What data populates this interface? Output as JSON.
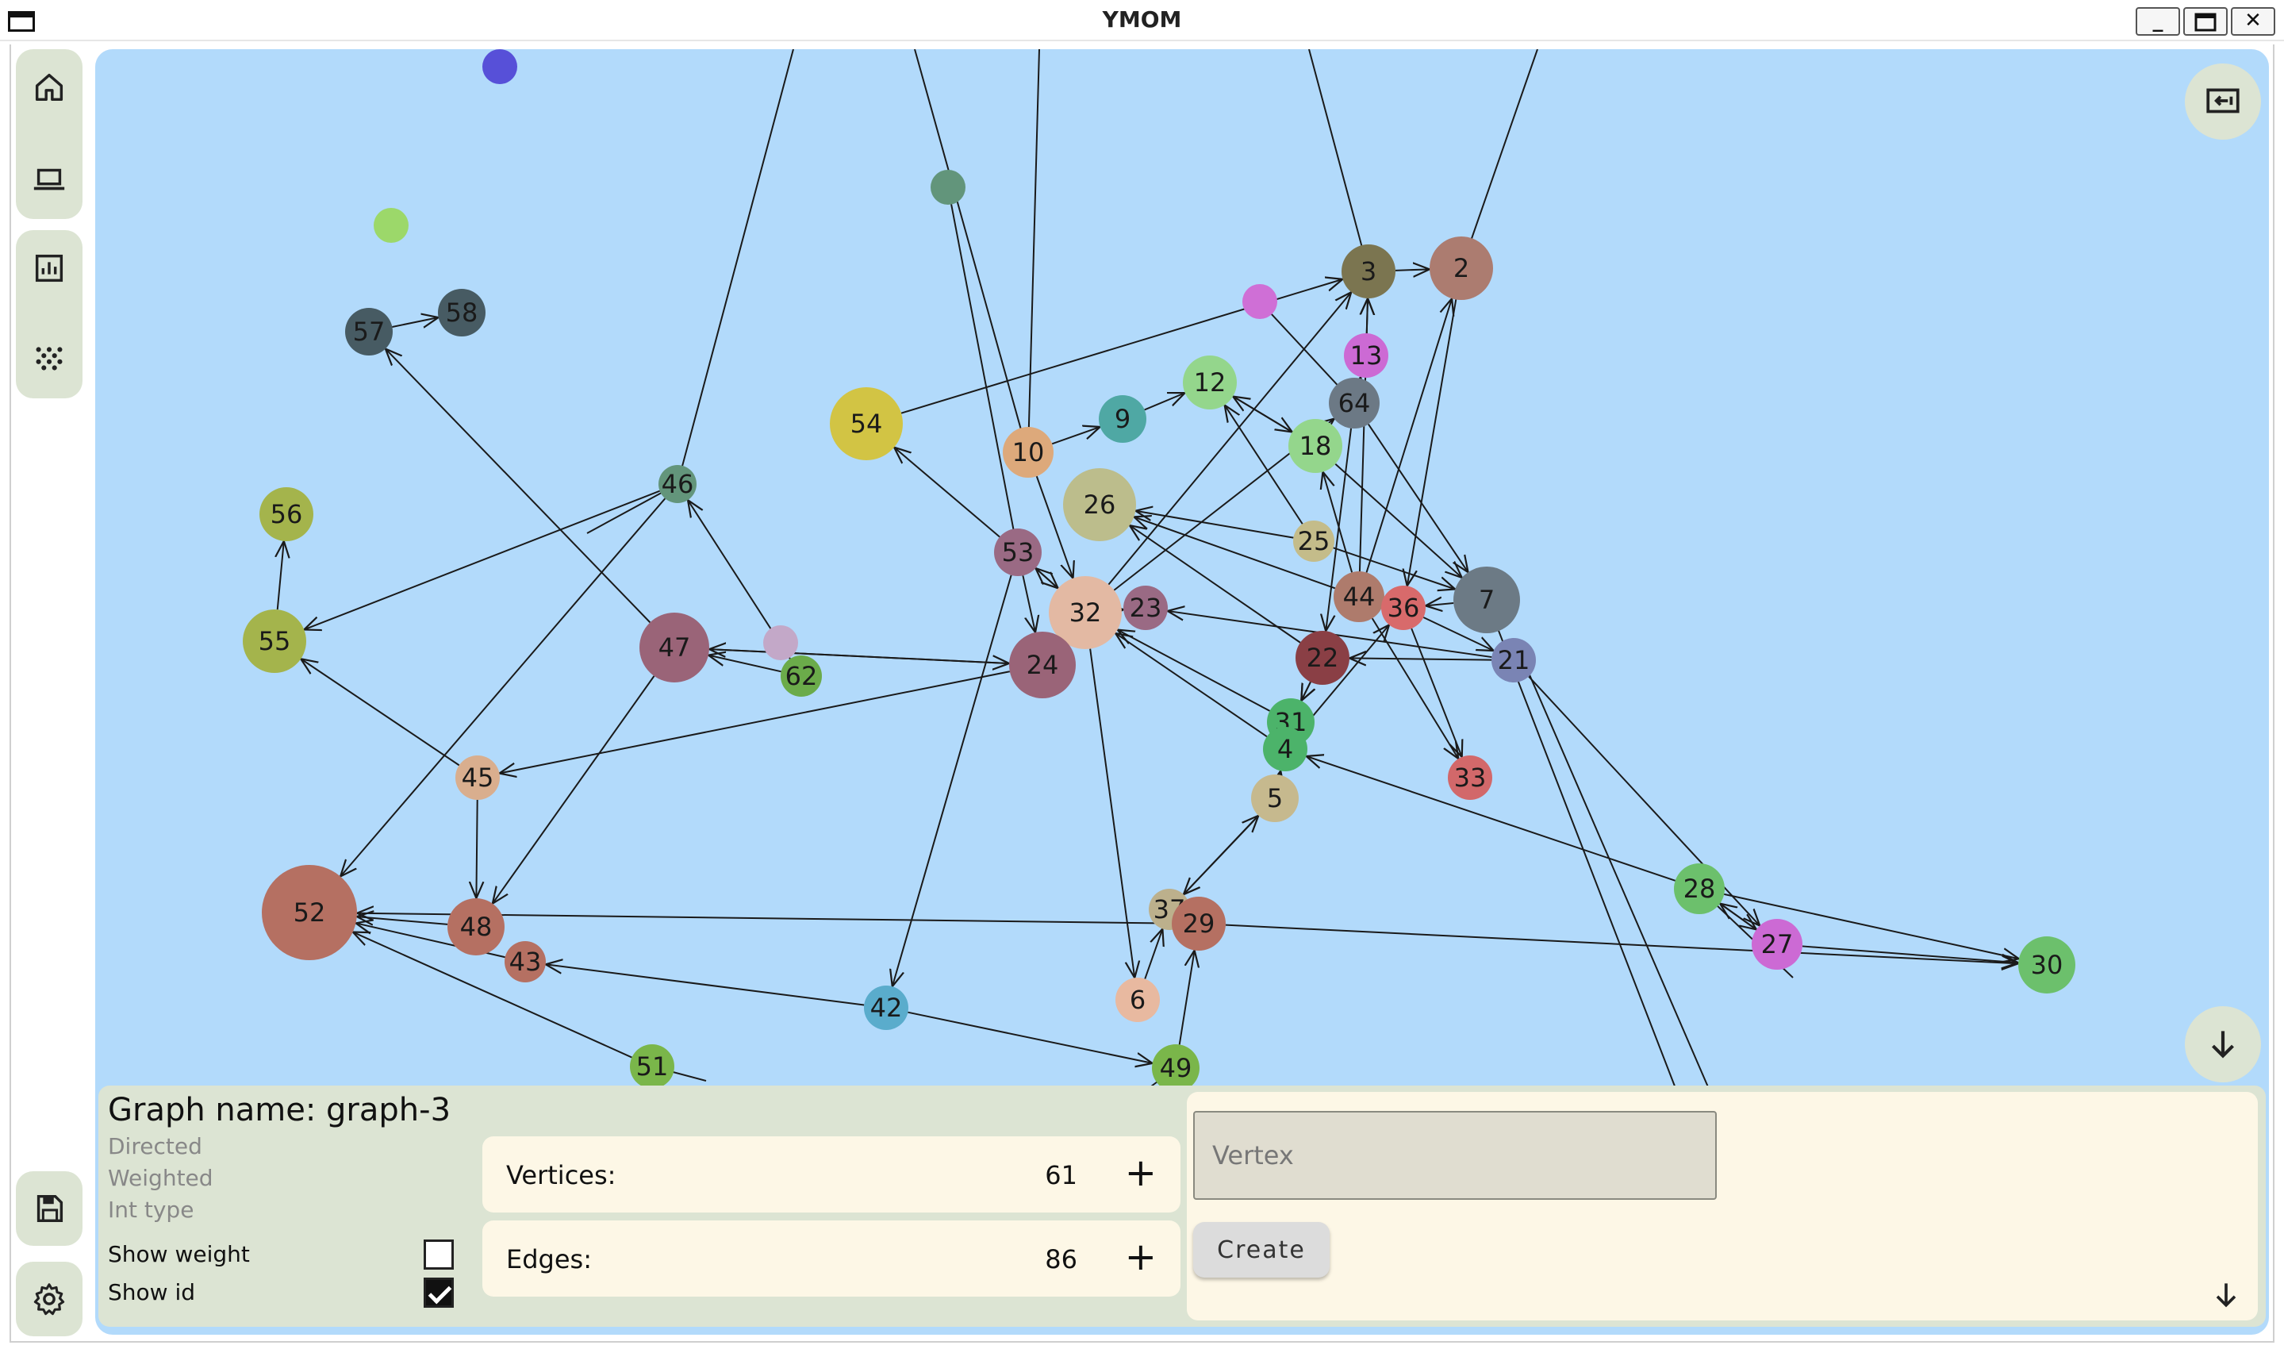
{
  "window": {
    "title": "YMOM"
  },
  "sidebar": {
    "top_items": [
      {
        "icon": "home-icon"
      },
      {
        "icon": "laptop-icon"
      },
      {
        "icon": "chart-icon"
      },
      {
        "icon": "dots-grid-icon"
      }
    ],
    "bottom_items": [
      {
        "icon": "save-icon"
      },
      {
        "icon": "gear-icon"
      }
    ]
  },
  "graph": {
    "vertices": [
      {
        "id": "",
        "color": "#5750d8"
      },
      {
        "id": "",
        "color": "#9cd86a"
      },
      {
        "id": "",
        "color": "#62957b"
      },
      {
        "id": "",
        "color": "#cf6fd6"
      },
      {
        "id": "",
        "color": "#c3a8c8"
      },
      {
        "id": "3",
        "color": "#7b7550"
      },
      {
        "id": "2",
        "color": "#ac7c70"
      },
      {
        "id": "13",
        "color": "#cc6ad4"
      },
      {
        "id": "64",
        "color": "#6c7985"
      },
      {
        "id": "57",
        "color": "#475b63"
      },
      {
        "id": "58",
        "color": "#475b63"
      },
      {
        "id": "54",
        "color": "#d2c444"
      },
      {
        "id": "12",
        "color": "#94d68c"
      },
      {
        "id": "9",
        "color": "#4fa8a4"
      },
      {
        "id": "10",
        "color": "#dda97b"
      },
      {
        "id": "18",
        "color": "#94d68c"
      },
      {
        "id": "46",
        "color": "#63957b"
      },
      {
        "id": "56",
        "color": "#a4b44c"
      },
      {
        "id": "26",
        "color": "#bcbd8c"
      },
      {
        "id": "25",
        "color": "#c4bc8a"
      },
      {
        "id": "53",
        "color": "#9a6a84"
      },
      {
        "id": "7",
        "color": "#6c7a85"
      },
      {
        "id": "44",
        "color": "#ae7b6c"
      },
      {
        "id": "36",
        "color": "#d86a6b"
      },
      {
        "id": "55",
        "color": "#a4b44c"
      },
      {
        "id": "47",
        "color": "#9a6478"
      },
      {
        "id": "32",
        "color": "#e3b9a3"
      },
      {
        "id": "23",
        "color": "#9a6a84"
      },
      {
        "id": "21",
        "color": "#7a84b4"
      },
      {
        "id": "22",
        "color": "#8a3f45"
      },
      {
        "id": "24",
        "color": "#9a6478"
      },
      {
        "id": "62",
        "color": "#6bab4a"
      },
      {
        "id": "31",
        "color": "#4cb36a"
      },
      {
        "id": "4",
        "color": "#4cb36a"
      },
      {
        "id": "45",
        "color": "#d9ae8e"
      },
      {
        "id": "33",
        "color": "#d2686a"
      },
      {
        "id": "5",
        "color": "#c6b98e"
      },
      {
        "id": "28",
        "color": "#6cc06c"
      },
      {
        "id": "52",
        "color": "#b57062"
      },
      {
        "id": "48",
        "color": "#b57062"
      },
      {
        "id": "37",
        "color": "#bcb08c"
      },
      {
        "id": "29",
        "color": "#b57062"
      },
      {
        "id": "27",
        "color": "#cc6ad4"
      },
      {
        "id": "30",
        "color": "#6cc06c"
      },
      {
        "id": "43",
        "color": "#b57062"
      },
      {
        "id": "6",
        "color": "#e8b9a0"
      },
      {
        "id": "42",
        "color": "#5aaccc"
      },
      {
        "id": "51",
        "color": "#7ab64a"
      },
      {
        "id": "49",
        "color": "#7ab64a"
      }
    ],
    "edges": [
      [
        "57",
        "58"
      ],
      [
        "46",
        "55"
      ],
      [
        "46",
        "52"
      ],
      [
        "47",
        "57"
      ],
      [
        "62",
        "46"
      ],
      [
        "54",
        "3"
      ],
      [
        "10",
        "9"
      ],
      [
        "9",
        "12"
      ],
      [
        "12",
        "18"
      ],
      [
        "18",
        "12"
      ],
      [
        "10",
        "32"
      ],
      [
        "53",
        "54"
      ],
      [
        "53",
        "32"
      ],
      [
        "53",
        "24"
      ],
      [
        "32",
        "53"
      ],
      [
        "32",
        "3"
      ],
      [
        "32",
        "64"
      ],
      [
        "25",
        "26"
      ],
      [
        "25",
        "12"
      ],
      [
        "44",
        "26"
      ],
      [
        "22",
        "26"
      ],
      [
        "44",
        "3"
      ],
      [
        "13",
        "3"
      ],
      [
        "3",
        "2"
      ],
      [
        "64",
        "13"
      ],
      [
        "64",
        "7"
      ],
      [
        "18",
        "7"
      ],
      [
        "64",
        "22"
      ],
      [
        "7",
        "36"
      ],
      [
        "36",
        "21"
      ],
      [
        "21",
        "22"
      ],
      [
        "21",
        "23"
      ],
      [
        "44",
        "18"
      ],
      [
        "36",
        "33"
      ],
      [
        "44",
        "33"
      ],
      [
        "21",
        "27"
      ],
      [
        "22",
        "31"
      ],
      [
        "31",
        "32"
      ],
      [
        "4",
        "32"
      ],
      [
        "4",
        "36"
      ],
      [
        "5",
        "4"
      ],
      [
        "5",
        "37"
      ],
      [
        "37",
        "5"
      ],
      [
        "28",
        "4"
      ],
      [
        "28",
        "30"
      ],
      [
        "28",
        "27"
      ],
      [
        "27",
        "28"
      ],
      [
        "29",
        "52"
      ],
      [
        "27",
        "30"
      ],
      [
        "29",
        "30"
      ],
      [
        "47",
        "24"
      ],
      [
        "24",
        "47"
      ],
      [
        "62",
        "47"
      ],
      [
        "24",
        "45"
      ],
      [
        "45",
        "55"
      ],
      [
        "55",
        "56"
      ],
      [
        "45",
        "48"
      ],
      [
        "47",
        "48"
      ],
      [
        "48",
        "52"
      ],
      [
        "43",
        "52"
      ],
      [
        "51",
        "52"
      ],
      [
        "42",
        "43"
      ],
      [
        "42",
        "49"
      ],
      [
        "53",
        "42"
      ],
      [
        "32",
        "6"
      ],
      [
        "6",
        "37"
      ],
      [
        "49",
        "29"
      ],
      [
        "44",
        "2"
      ],
      [
        "25",
        "7"
      ],
      [
        "22",
        "31"
      ],
      [
        "2",
        "36"
      ],
      [
        "32",
        "23"
      ]
    ]
  },
  "panel": {
    "graph_name": "Graph name: graph-3",
    "flags": [
      "Directed",
      "Weighted",
      "Int type"
    ],
    "show_weight": {
      "label": "Show weight",
      "checked": false
    },
    "show_id": {
      "label": "Show id",
      "checked": true
    },
    "vertices": {
      "label": "Vertices:",
      "value": "61",
      "action": "+"
    },
    "edges": {
      "label": "Edges:",
      "value": "86",
      "action": "+"
    },
    "vertex_input": {
      "placeholder": "Vertex",
      "value": ""
    },
    "create_label": "Create"
  },
  "colors": {
    "canvas_bg": "#b2dafb",
    "panel_bg": "#dce4d3",
    "card_bg": "#fdf7e6",
    "edge": "#1a1a1a"
  }
}
